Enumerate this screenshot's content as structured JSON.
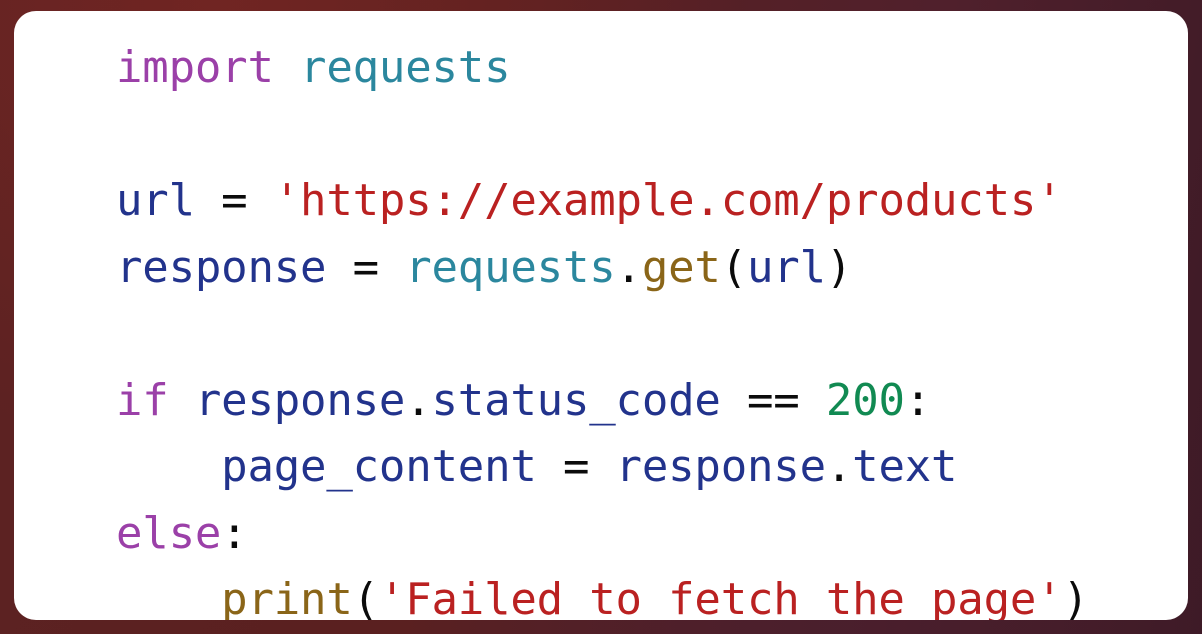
{
  "card": {
    "name": "python-code-snippet-card",
    "frame_color": "#5a2020",
    "surface_color": "#ffffff",
    "corner_radius_px": 22,
    "language": "python"
  },
  "theme": {
    "keyword": "#9B40A8",
    "module": "#2b879e",
    "name": "#22338c",
    "builtin": "#8a6518",
    "string": "#ba2121",
    "number": "#118a52",
    "operator": "#0b0b0b",
    "punct": "#0b0b0b",
    "background": "#ffffff",
    "border": "#5a2020"
  },
  "code": {
    "plain_text": "import requests\n\nurl = 'https://example.com/products'\nresponse = requests.get(url)\n\nif response.status_code == 200:\n    page_content = response.text\nelse:\n    print('Failed to fetch the page')",
    "lines": [
      {
        "index": 0,
        "indent": 0,
        "text": "import requests",
        "tokens": [
          {
            "t": "import",
            "k": "keyword"
          },
          {
            "t": " ",
            "k": "plain"
          },
          {
            "t": "requests",
            "k": "module"
          }
        ]
      },
      {
        "index": 1,
        "indent": 0,
        "text": "",
        "tokens": []
      },
      {
        "index": 2,
        "indent": 0,
        "text": "url = 'https://example.com/products'",
        "tokens": [
          {
            "t": "url",
            "k": "name"
          },
          {
            "t": " ",
            "k": "plain"
          },
          {
            "t": "=",
            "k": "operator"
          },
          {
            "t": " ",
            "k": "plain"
          },
          {
            "t": "'https://example.com/products'",
            "k": "string"
          }
        ]
      },
      {
        "index": 3,
        "indent": 0,
        "text": "response = requests.get(url)",
        "tokens": [
          {
            "t": "response",
            "k": "name"
          },
          {
            "t": " ",
            "k": "plain"
          },
          {
            "t": "=",
            "k": "operator"
          },
          {
            "t": " ",
            "k": "plain"
          },
          {
            "t": "requests",
            "k": "module"
          },
          {
            "t": ".",
            "k": "punct"
          },
          {
            "t": "get",
            "k": "builtin"
          },
          {
            "t": "(",
            "k": "punct"
          },
          {
            "t": "url",
            "k": "name"
          },
          {
            "t": ")",
            "k": "punct"
          }
        ]
      },
      {
        "index": 4,
        "indent": 0,
        "text": "",
        "tokens": []
      },
      {
        "index": 5,
        "indent": 0,
        "text": "if response.status_code == 200:",
        "tokens": [
          {
            "t": "if",
            "k": "keyword"
          },
          {
            "t": " ",
            "k": "plain"
          },
          {
            "t": "response",
            "k": "name"
          },
          {
            "t": ".",
            "k": "punct"
          },
          {
            "t": "status_code",
            "k": "name"
          },
          {
            "t": " ",
            "k": "plain"
          },
          {
            "t": "==",
            "k": "operator"
          },
          {
            "t": " ",
            "k": "plain"
          },
          {
            "t": "200",
            "k": "number"
          },
          {
            "t": ":",
            "k": "punct"
          }
        ]
      },
      {
        "index": 6,
        "indent": 4,
        "text": "    page_content = response.text",
        "tokens": [
          {
            "t": "    ",
            "k": "plain"
          },
          {
            "t": "page_content",
            "k": "name"
          },
          {
            "t": " ",
            "k": "plain"
          },
          {
            "t": "=",
            "k": "operator"
          },
          {
            "t": " ",
            "k": "plain"
          },
          {
            "t": "response",
            "k": "name"
          },
          {
            "t": ".",
            "k": "punct"
          },
          {
            "t": "text",
            "k": "name"
          }
        ]
      },
      {
        "index": 7,
        "indent": 0,
        "text": "else:",
        "tokens": [
          {
            "t": "else",
            "k": "keyword"
          },
          {
            "t": ":",
            "k": "punct"
          }
        ]
      },
      {
        "index": 8,
        "indent": 4,
        "text": "    print('Failed to fetch the page')",
        "tokens": [
          {
            "t": "    ",
            "k": "plain"
          },
          {
            "t": "print",
            "k": "builtin"
          },
          {
            "t": "(",
            "k": "punct"
          },
          {
            "t": "'Failed to fetch the page'",
            "k": "string"
          },
          {
            "t": ")",
            "k": "punct"
          }
        ]
      }
    ]
  }
}
